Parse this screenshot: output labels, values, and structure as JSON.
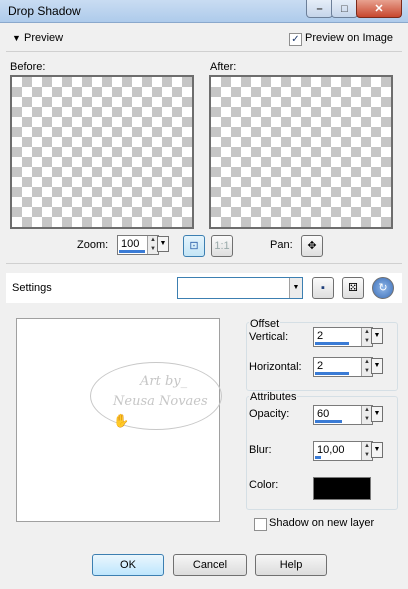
{
  "window": {
    "title": "Drop Shadow",
    "min": "–",
    "max": "□",
    "close": "✕"
  },
  "preview": {
    "toggle_label": "Preview",
    "preview_on_image_label": "Preview on Image",
    "preview_on_image_checked": true,
    "before_label": "Before:",
    "after_label": "After:",
    "zoom_label": "Zoom:",
    "zoom_value": "100",
    "pan_label": "Pan:"
  },
  "settings": {
    "label": "Settings",
    "value": ""
  },
  "watermark": {
    "line1": "Art by_",
    "line2": "Neusa Novaes"
  },
  "offset": {
    "group_label": "Offset",
    "vertical_label": "Vertical:",
    "vertical_value": "2",
    "horizontal_label": "Horizontal:",
    "horizontal_value": "2"
  },
  "attributes": {
    "group_label": "Attributes",
    "opacity_label": "Opacity:",
    "opacity_value": "60",
    "blur_label": "Blur:",
    "blur_value": "10,00",
    "color_label": "Color:",
    "color_hex": "#000000"
  },
  "shadow_on_new_layer": {
    "label": "Shadow on new layer",
    "checked": false
  },
  "buttons": {
    "ok": "OK",
    "cancel": "Cancel",
    "help": "Help"
  },
  "colors": {
    "accent": "#3a7bd5",
    "title_bar": "#c9dcf2"
  }
}
